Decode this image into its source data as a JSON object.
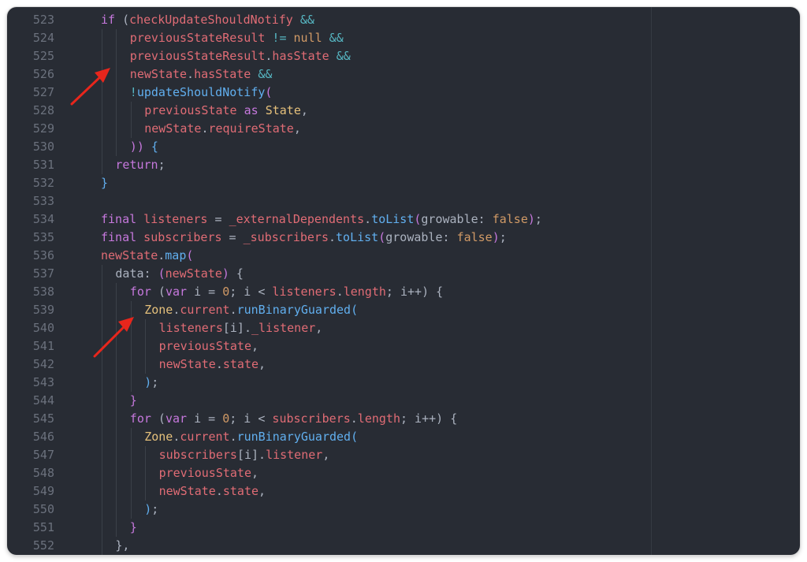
{
  "editor": {
    "lines": [
      {
        "num": "523",
        "indent": 0,
        "tokens": [
          [
            "kw",
            "if"
          ],
          [
            "pl",
            " ("
          ],
          [
            "var",
            "checkUpdateShouldNotify"
          ],
          [
            "op",
            " &&"
          ]
        ]
      },
      {
        "num": "524",
        "indent": 2,
        "tokens": [
          [
            "var",
            "previousStateResult"
          ],
          [
            "op",
            " !="
          ],
          [
            "num",
            " null"
          ],
          [
            "op",
            " &&"
          ]
        ]
      },
      {
        "num": "525",
        "indent": 2,
        "tokens": [
          [
            "var",
            "previousStateResult"
          ],
          [
            "pl",
            "."
          ],
          [
            "var",
            "hasState"
          ],
          [
            "op",
            " &&"
          ]
        ]
      },
      {
        "num": "526",
        "indent": 2,
        "tokens": [
          [
            "var",
            "newState"
          ],
          [
            "pl",
            "."
          ],
          [
            "var",
            "hasState"
          ],
          [
            "op",
            " &&"
          ]
        ]
      },
      {
        "num": "527",
        "indent": 2,
        "tokens": [
          [
            "op",
            "!"
          ],
          [
            "fn",
            "updateShouldNotify"
          ],
          [
            "kw",
            "("
          ]
        ]
      },
      {
        "num": "528",
        "indent": 3,
        "tokens": [
          [
            "var",
            "previousState"
          ],
          [
            "kw",
            " as"
          ],
          [
            "cls",
            " State"
          ],
          [
            "pl",
            ","
          ]
        ]
      },
      {
        "num": "529",
        "indent": 3,
        "tokens": [
          [
            "var",
            "newState"
          ],
          [
            "pl",
            "."
          ],
          [
            "var",
            "requireState"
          ],
          [
            "pl",
            ","
          ]
        ]
      },
      {
        "num": "530",
        "indent": 2,
        "tokens": [
          [
            "kw",
            "))"
          ],
          [
            "pl",
            " "
          ],
          [
            "fn",
            "{"
          ]
        ]
      },
      {
        "num": "531",
        "indent": 1,
        "tokens": [
          [
            "kw",
            "return"
          ],
          [
            "pl",
            ";"
          ]
        ]
      },
      {
        "num": "532",
        "indent": 0,
        "tokens": [
          [
            "fn",
            "}"
          ]
        ]
      },
      {
        "num": "533",
        "indent": 0,
        "tokens": []
      },
      {
        "num": "534",
        "indent": 0,
        "tokens": [
          [
            "kw",
            "final"
          ],
          [
            "var",
            " listeners"
          ],
          [
            "pl",
            " = "
          ],
          [
            "var",
            "_externalDependents"
          ],
          [
            "pl",
            "."
          ],
          [
            "fn",
            "toList"
          ],
          [
            "kw",
            "("
          ],
          [
            "pl",
            "growable: "
          ],
          [
            "num",
            "false"
          ],
          [
            "kw",
            ")"
          ],
          [
            "pl",
            ";"
          ]
        ]
      },
      {
        "num": "535",
        "indent": 0,
        "tokens": [
          [
            "kw",
            "final"
          ],
          [
            "var",
            " subscribers"
          ],
          [
            "pl",
            " = "
          ],
          [
            "var",
            "_subscribers"
          ],
          [
            "pl",
            "."
          ],
          [
            "fn",
            "toList"
          ],
          [
            "kw",
            "("
          ],
          [
            "pl",
            "growable: "
          ],
          [
            "num",
            "false"
          ],
          [
            "kw",
            ")"
          ],
          [
            "pl",
            ";"
          ]
        ]
      },
      {
        "num": "536",
        "indent": 0,
        "tokens": [
          [
            "var",
            "newState"
          ],
          [
            "pl",
            "."
          ],
          [
            "fn",
            "map"
          ],
          [
            "kw",
            "("
          ]
        ]
      },
      {
        "num": "537",
        "indent": 1,
        "tokens": [
          [
            "pl",
            "data: "
          ],
          [
            "kw",
            "("
          ],
          [
            "var",
            "newState"
          ],
          [
            "kw",
            ")"
          ],
          [
            "pl",
            " {"
          ]
        ]
      },
      {
        "num": "538",
        "indent": 2,
        "tokens": [
          [
            "kw",
            "for"
          ],
          [
            "pl",
            " ("
          ],
          [
            "kw",
            "var"
          ],
          [
            "pl",
            " i = "
          ],
          [
            "num",
            "0"
          ],
          [
            "pl",
            "; i < "
          ],
          [
            "var",
            "listeners"
          ],
          [
            "pl",
            "."
          ],
          [
            "var",
            "length"
          ],
          [
            "pl",
            "; i++) {"
          ]
        ]
      },
      {
        "num": "539",
        "indent": 3,
        "tokens": [
          [
            "cls",
            "Zone"
          ],
          [
            "pl",
            "."
          ],
          [
            "var",
            "current"
          ],
          [
            "pl",
            "."
          ],
          [
            "fn",
            "runBinaryGuarded"
          ],
          [
            "fn",
            "("
          ]
        ]
      },
      {
        "num": "540",
        "indent": 4,
        "tokens": [
          [
            "var",
            "listeners"
          ],
          [
            "pl",
            "[i]."
          ],
          [
            "var",
            "_listener"
          ],
          [
            "pl",
            ","
          ]
        ]
      },
      {
        "num": "541",
        "indent": 4,
        "tokens": [
          [
            "var",
            "previousState"
          ],
          [
            "pl",
            ","
          ]
        ]
      },
      {
        "num": "542",
        "indent": 4,
        "tokens": [
          [
            "var",
            "newState"
          ],
          [
            "pl",
            "."
          ],
          [
            "var",
            "state"
          ],
          [
            "pl",
            ","
          ]
        ]
      },
      {
        "num": "543",
        "indent": 3,
        "tokens": [
          [
            "fn",
            ")"
          ],
          [
            "pl",
            ";"
          ]
        ]
      },
      {
        "num": "544",
        "indent": 2,
        "tokens": [
          [
            "kw",
            "}"
          ]
        ]
      },
      {
        "num": "545",
        "indent": 2,
        "tokens": [
          [
            "kw",
            "for"
          ],
          [
            "pl",
            " ("
          ],
          [
            "kw",
            "var"
          ],
          [
            "pl",
            " i = "
          ],
          [
            "num",
            "0"
          ],
          [
            "pl",
            "; i < "
          ],
          [
            "var",
            "subscribers"
          ],
          [
            "pl",
            "."
          ],
          [
            "var",
            "length"
          ],
          [
            "pl",
            "; i++) {"
          ]
        ]
      },
      {
        "num": "546",
        "indent": 3,
        "tokens": [
          [
            "cls",
            "Zone"
          ],
          [
            "pl",
            "."
          ],
          [
            "var",
            "current"
          ],
          [
            "pl",
            "."
          ],
          [
            "fn",
            "runBinaryGuarded"
          ],
          [
            "fn",
            "("
          ]
        ]
      },
      {
        "num": "547",
        "indent": 4,
        "tokens": [
          [
            "var",
            "subscribers"
          ],
          [
            "pl",
            "[i]."
          ],
          [
            "var",
            "listener"
          ],
          [
            "pl",
            ","
          ]
        ]
      },
      {
        "num": "548",
        "indent": 4,
        "tokens": [
          [
            "var",
            "previousState"
          ],
          [
            "pl",
            ","
          ]
        ]
      },
      {
        "num": "549",
        "indent": 4,
        "tokens": [
          [
            "var",
            "newState"
          ],
          [
            "pl",
            "."
          ],
          [
            "var",
            "state"
          ],
          [
            "pl",
            ","
          ]
        ]
      },
      {
        "num": "550",
        "indent": 3,
        "tokens": [
          [
            "fn",
            ")"
          ],
          [
            "pl",
            ";"
          ]
        ]
      },
      {
        "num": "551",
        "indent": 2,
        "tokens": [
          [
            "kw",
            "}"
          ]
        ]
      },
      {
        "num": "552",
        "indent": 1,
        "tokens": [
          [
            "pl",
            "},"
          ]
        ]
      }
    ]
  },
  "colors": {
    "background": "#282c34",
    "line_number": "#6b717d",
    "keyword": "#c678dd",
    "function": "#61afef",
    "variable": "#e06c75",
    "plain": "#abb2bf",
    "class": "#e5c07b",
    "number": "#d19a66",
    "operator": "#56b6c2",
    "annotation_arrow": "#e8261c"
  },
  "annotations": [
    {
      "type": "arrow",
      "icon": "red-arrow-icon",
      "points_to_line": "526"
    },
    {
      "type": "arrow",
      "icon": "red-arrow-icon",
      "points_to_line": "539"
    }
  ]
}
